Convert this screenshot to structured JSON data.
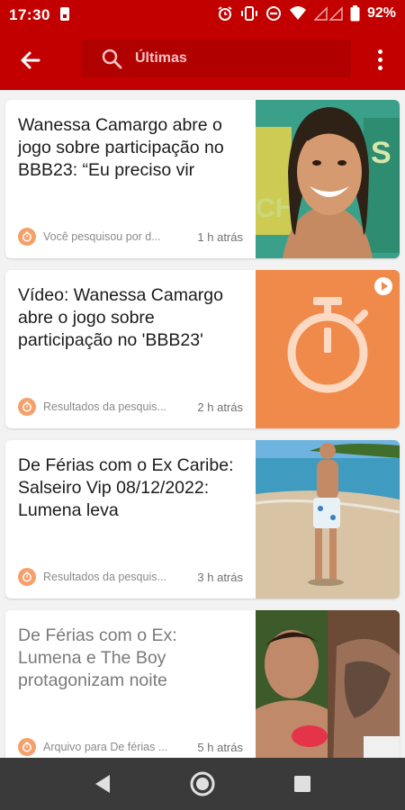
{
  "status_bar": {
    "time": "17:30",
    "battery": "92%",
    "icons": [
      "sim-icon",
      "alarm-icon",
      "vibrate-icon",
      "dnd-icon",
      "wifi-icon",
      "signal-icon",
      "battery-icon"
    ]
  },
  "app_bar": {
    "back_icon": "arrow-left-icon",
    "search_text": "Últimas",
    "search_icon": "search-icon",
    "menu_icon": "more-vert-icon"
  },
  "feed": {
    "items": [
      {
        "title": "Wanessa Camargo abre o jogo sobre participação no BBB23: “Eu preciso vir",
        "source": "Você pesquisou por d...",
        "time": "1 h atrás",
        "thumbnail": "photo-woman-smiling"
      },
      {
        "title": "Vídeo: Wanessa Camargo abre o jogo sobre participação no 'BBB23'",
        "source": "Resultados da pesquis...",
        "time": "2 h atrás",
        "thumbnail": "stopwatch-placeholder"
      },
      {
        "title": "De Férias com o Ex Caribe: Salseiro Vip 08/12/2022: Lumena leva",
        "source": "Resultados da pesquis...",
        "time": "3 h atrás",
        "thumbnail": "photo-man-on-beach"
      },
      {
        "title": "De Férias com o Ex: Lumena e The Boy protagonizam noite",
        "source": "Arquivo para De férias ...",
        "time": "5 h atrás",
        "thumbnail": "photo-couple"
      }
    ]
  },
  "nav_bar": {
    "back_icon": "nav-back-icon",
    "home_icon": "nav-home-icon",
    "recents_icon": "nav-recents-icon"
  },
  "colors": {
    "brand_red": "#c30000",
    "accent_orange": "#f5a06b",
    "thumb_orange": "#f08a4b",
    "nav_bar": "#3a3a3a"
  }
}
